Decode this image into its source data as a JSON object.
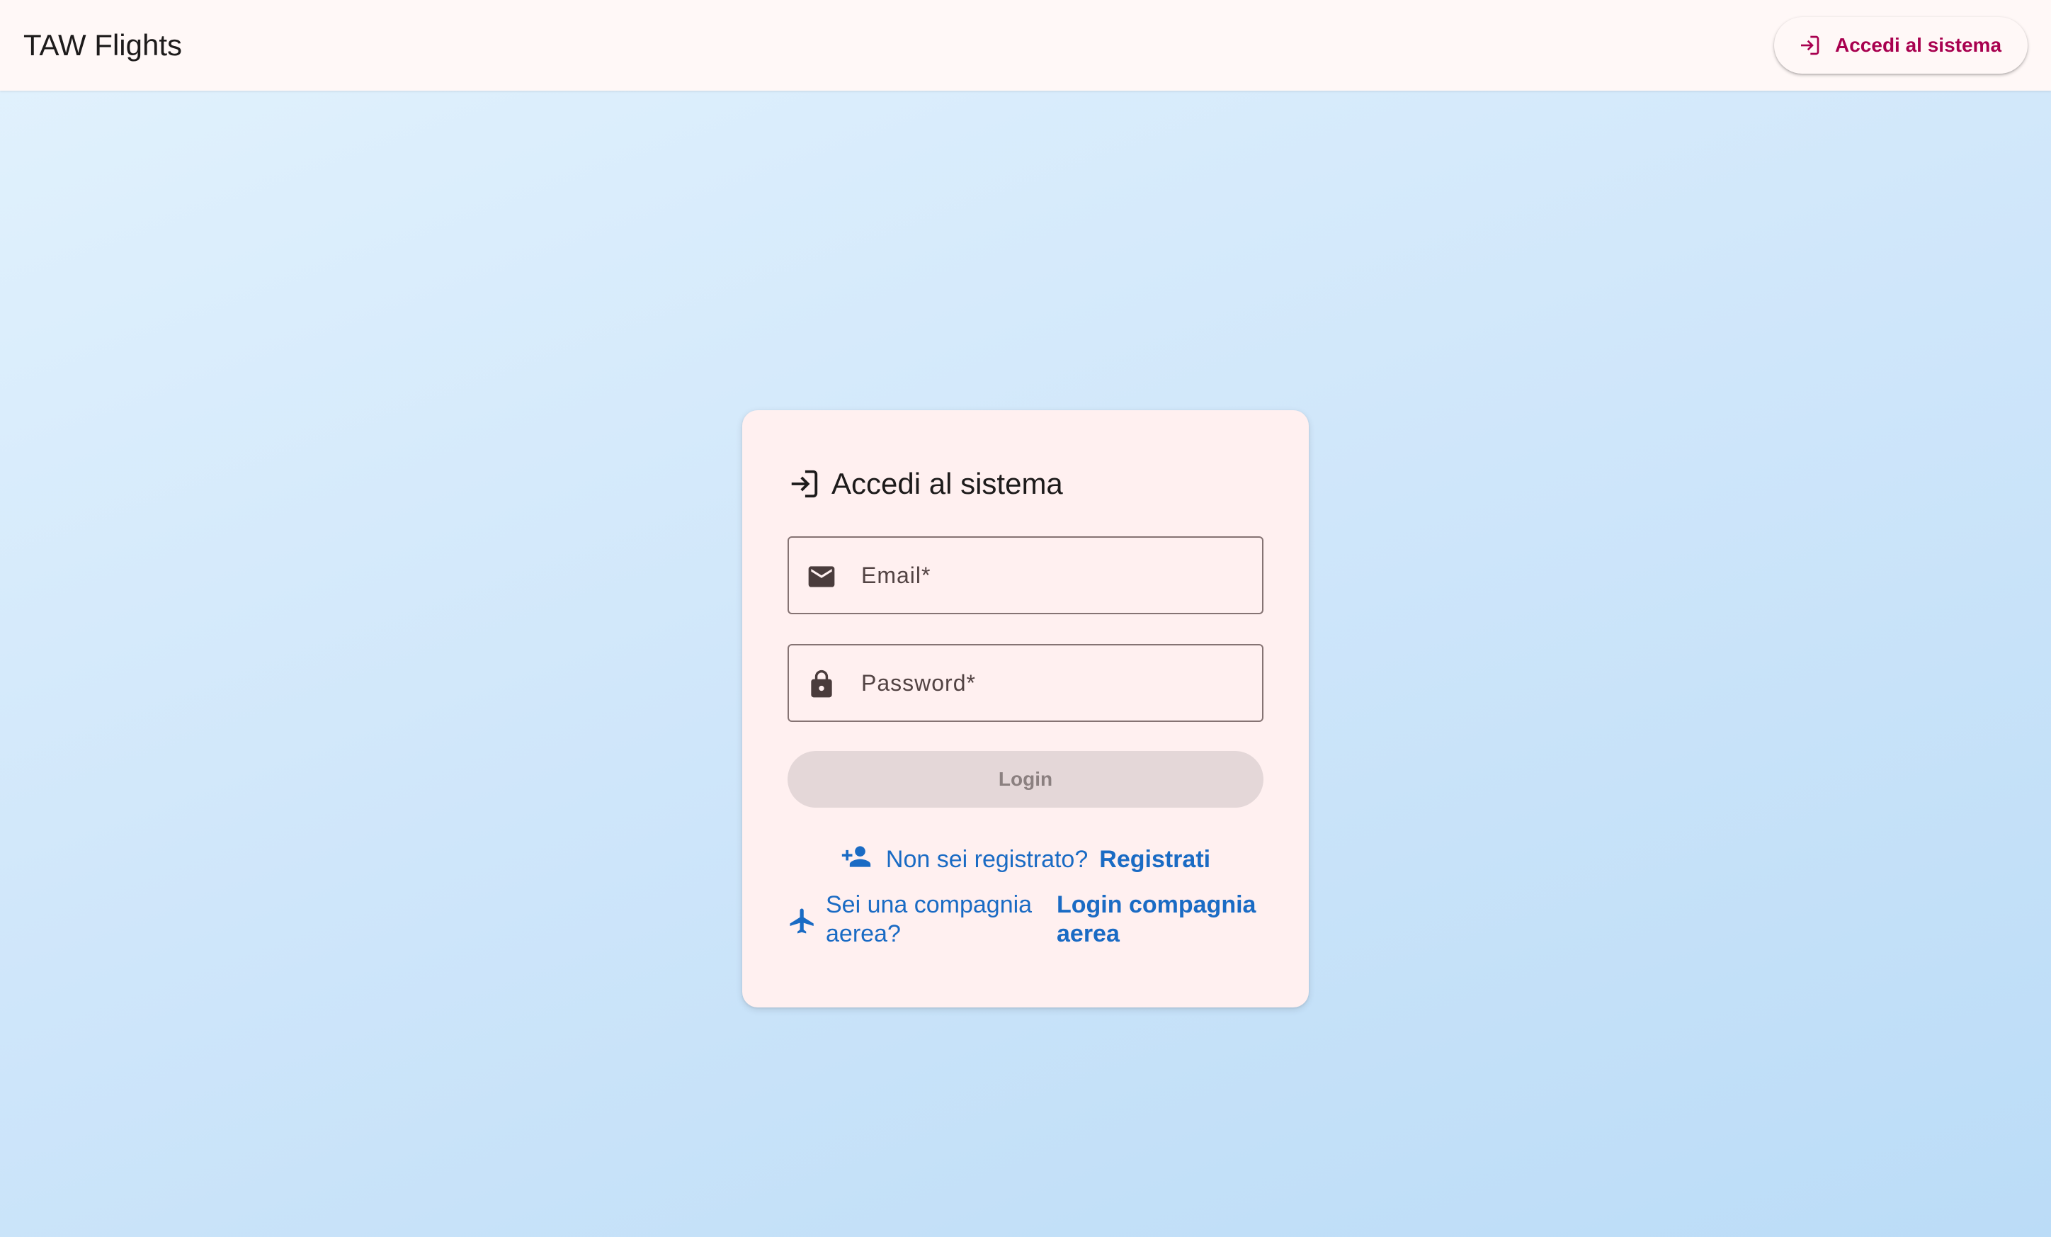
{
  "header": {
    "app_title": "TAW Flights",
    "login_button_label": "Accedi al sistema",
    "login_button_icon": "login-icon"
  },
  "card": {
    "title": "Accedi al sistema",
    "title_icon": "login-icon",
    "email_field": {
      "label": "Email*",
      "value": "",
      "icon": "email-icon"
    },
    "password_field": {
      "label": "Password*",
      "value": "",
      "icon": "lock-icon"
    },
    "login_button_label": "Login",
    "register": {
      "icon": "person-add-icon",
      "question": "Non sei registrato?",
      "link_label": "Registrati"
    },
    "airline": {
      "icon": "airplane-icon",
      "question": "Sei una compagnia aerea?",
      "link_label": "Login compagnia aerea"
    }
  },
  "colors": {
    "accent": "#a8004f",
    "link": "#1a6bc4",
    "surface": "#fff0f0",
    "disabled_button": "#e4d7d8"
  }
}
